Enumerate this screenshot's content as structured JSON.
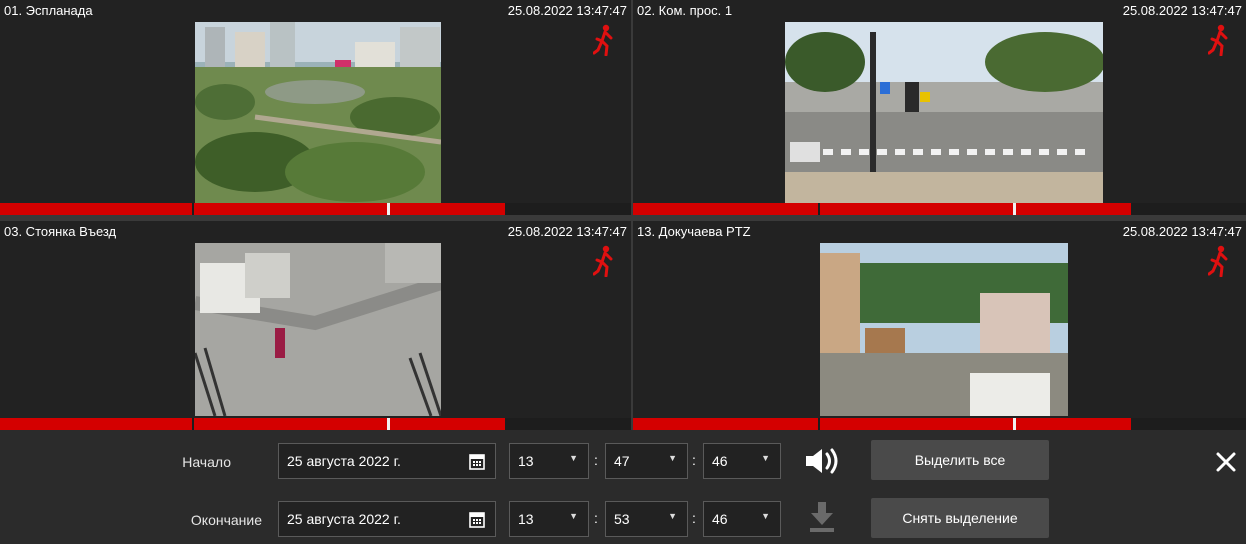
{
  "cameras": [
    {
      "name": "01. Эспланада",
      "timestamp": "25.08.2022 13:47:47",
      "motion_icon": "running-person-icon"
    },
    {
      "name": "02. Ком. прос. 1",
      "timestamp": "25.08.2022 13:47:47",
      "motion_icon": "running-person-icon"
    },
    {
      "name": "03. Стоянка Въезд",
      "timestamp": "25.08.2022 13:47:47",
      "motion_icon": "running-person-icon"
    },
    {
      "name": "13. Докучаева PTZ",
      "timestamp": "25.08.2022 13:47:47",
      "motion_icon": "running-person-icon"
    }
  ],
  "export": {
    "start_label": "Начало",
    "end_label": "Окончание",
    "start_date": "25 августа 2022 г.",
    "end_date": "25 августа 2022 г.",
    "start_hour": "13",
    "start_minute": "47",
    "start_second": "46",
    "end_hour": "13",
    "end_minute": "53",
    "end_second": "46",
    "time_separator": ":",
    "select_all": "Выделить все",
    "deselect": "Снять выделение",
    "icons": [
      "calendar-icon",
      "dropdown-arrow-icon",
      "volume-icon",
      "download-icon",
      "close-icon"
    ]
  },
  "colors": {
    "timeline_red": "#d40000",
    "motion_red": "#e01010",
    "background": "#2b2b2b"
  }
}
